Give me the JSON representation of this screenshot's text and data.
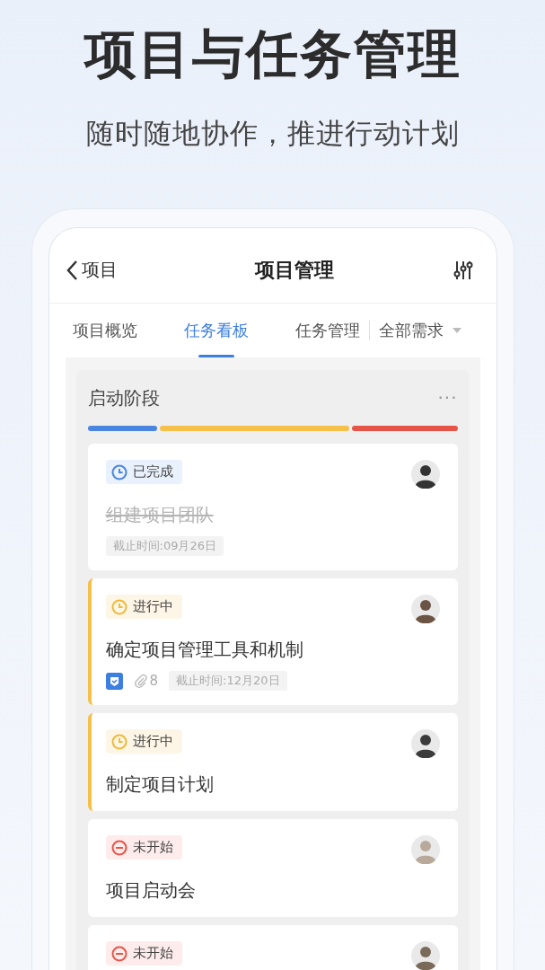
{
  "headline": "项目与任务管理",
  "subtitle": "随时随地协作，推进行动计划",
  "nav": {
    "back": "项目",
    "title": "项目管理"
  },
  "tabs": [
    {
      "label": "项目概览",
      "selected": false
    },
    {
      "label": "任务看板",
      "selected": true
    },
    {
      "label": "任务管理",
      "selected": false
    }
  ],
  "filter": {
    "label": "全部需求"
  },
  "column": {
    "title": "启动阶段",
    "more": "···",
    "progress": [
      {
        "color": "#4a86e0"
      },
      {
        "color": "#f5c04a"
      },
      {
        "color": "#e65448"
      }
    ],
    "cards": [
      {
        "status": {
          "kind": "done",
          "label": "已完成"
        },
        "title": "组建项目团队",
        "deadline": "截止时间:09月26日"
      },
      {
        "status": {
          "kind": "doing",
          "label": "进行中"
        },
        "title": "确定项目管理工具和机制",
        "checklist": true,
        "attachments": "8",
        "deadline": "截止时间:12月20日"
      },
      {
        "status": {
          "kind": "doing",
          "label": "进行中"
        },
        "title": "制定项目计划"
      },
      {
        "status": {
          "kind": "todo",
          "label": "未开始"
        },
        "title": "项目启动会"
      },
      {
        "status": {
          "kind": "todo",
          "label": "未开始"
        }
      }
    ]
  }
}
